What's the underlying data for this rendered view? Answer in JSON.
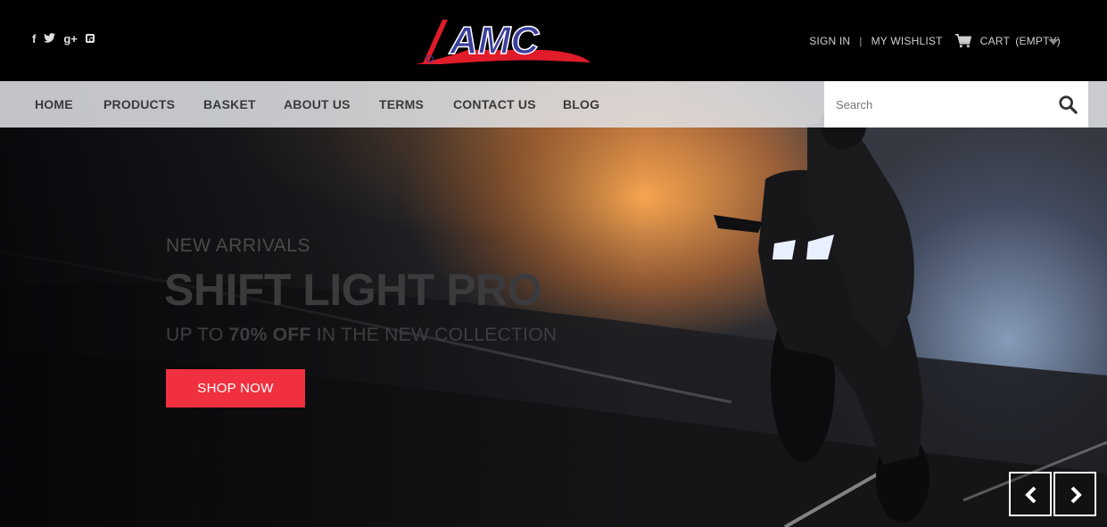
{
  "header": {
    "social": [
      "f",
      "twitter",
      "g+",
      "instagram"
    ],
    "logo_text": "AMC",
    "account": {
      "signin": "SIGN IN",
      "wishlist": "MY WISHLIST",
      "cart": "CART",
      "cart_status": "(EMPTY)"
    }
  },
  "nav": {
    "items": [
      "HOME",
      "PRODUCTS",
      "BASKET",
      "ABOUT US",
      "TERMS",
      "CONTACT US",
      "BLOG"
    ],
    "search_placeholder": "Search"
  },
  "hero": {
    "kicker": "NEW ARRIVALS",
    "headline": "SHIFT LIGHT PRO",
    "sub_prefix": "UP TO",
    "sub_bold": "70% OFF",
    "sub_suffix": "IN THE NEW COLLECTION",
    "cta": "SHOP NOW"
  },
  "colors": {
    "accent": "#f0303e",
    "logo_blue": "#3b3f9c",
    "logo_red": "#e01b2a"
  }
}
